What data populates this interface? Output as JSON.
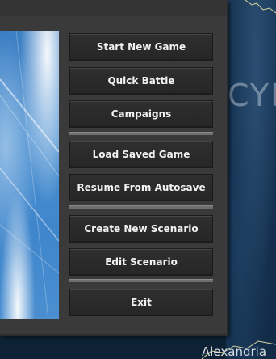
{
  "map": {
    "region_label": "CYP",
    "city_label": "Alexandria"
  },
  "menu": {
    "buttons": {
      "start_new_game": "Start New Game",
      "quick_battle": "Quick Battle",
      "campaigns": "Campaigns",
      "load_saved_game": "Load Saved Game",
      "resume_from_autosave": "Resume From Autosave",
      "create_new_scenario": "Create New Scenario",
      "edit_scenario": "Edit Scenario",
      "exit": "Exit"
    }
  }
}
